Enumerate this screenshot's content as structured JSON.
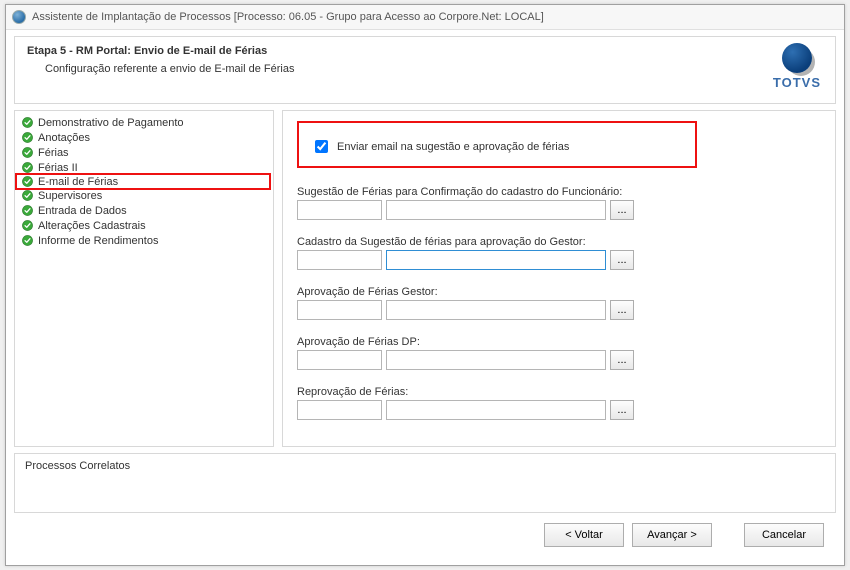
{
  "window": {
    "title": "Assistente de Implantação de Processos [Processo: 06.05 - Grupo para Acesso ao Corpore.Net: LOCAL]"
  },
  "header": {
    "step_title": "Etapa 5 - RM Portal: Envio de E-mail de Férias",
    "step_subtitle": "Configuração referente a envio de E-mail de Férias",
    "logo_text": "TOTVS"
  },
  "sidebar": {
    "items": [
      {
        "label": "Demonstrativo de Pagamento",
        "selected": false
      },
      {
        "label": "Anotações",
        "selected": false
      },
      {
        "label": "Férias",
        "selected": false
      },
      {
        "label": "Férias II",
        "selected": false
      },
      {
        "label": "E-mail de Férias",
        "selected": true
      },
      {
        "label": "Supervisores",
        "selected": false
      },
      {
        "label": "Entrada de Dados",
        "selected": false
      },
      {
        "label": "Alterações Cadastrais",
        "selected": false
      },
      {
        "label": "Informe de Rendimentos",
        "selected": false
      }
    ]
  },
  "form": {
    "send_email_checkbox_label": "Enviar email na sugestão e aprovação de férias",
    "send_email_checked": true,
    "groups": [
      {
        "label": "Sugestão de Férias para Confirmação do cadastro do Funcionário:",
        "code": "",
        "desc": "",
        "focused": false
      },
      {
        "label": "Cadastro da Sugestão de férias para aprovação do Gestor:",
        "code": "",
        "desc": "",
        "focused": true
      },
      {
        "label": "Aprovação de Férias Gestor:",
        "code": "",
        "desc": "",
        "focused": false
      },
      {
        "label": "Aprovação de Férias DP:",
        "code": "",
        "desc": "",
        "focused": false
      },
      {
        "label": "Reprovação de Férias:",
        "code": "",
        "desc": "",
        "focused": false
      }
    ],
    "ellipsis": "..."
  },
  "bottom": {
    "title": "Processos Correlatos"
  },
  "footer": {
    "back": "< Voltar",
    "next": "Avançar >",
    "cancel": "Cancelar"
  }
}
